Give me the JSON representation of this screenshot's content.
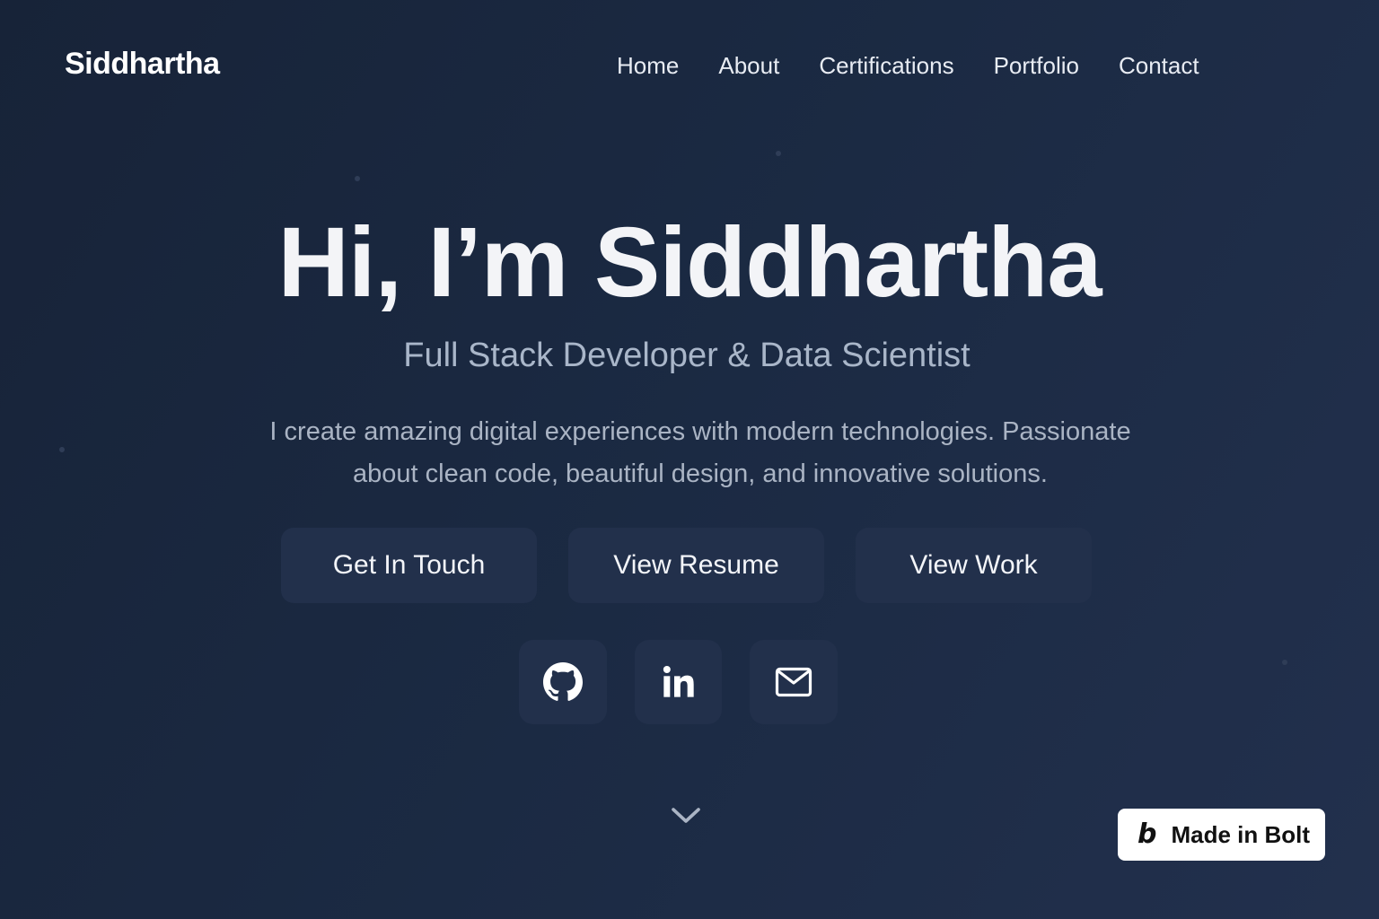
{
  "header": {
    "logo": "Siddhartha",
    "nav": [
      "Home",
      "About",
      "Certifications",
      "Portfolio",
      "Contact"
    ]
  },
  "hero": {
    "title": "Hi, I’m Siddhartha",
    "subtitle": "Full Stack Developer & Data Scientist",
    "description_line1": "I create amazing digital experiences with modern technologies. Passionate",
    "description_line2": "about clean code, beautiful design, and innovative solutions.",
    "buttons": [
      "Get In Touch",
      "View Resume",
      "View Work"
    ]
  },
  "social": {
    "icons": [
      "github-icon",
      "linkedin-icon",
      "mail-icon"
    ]
  },
  "scroll_indicator": {
    "icon": "chevron-down-icon"
  },
  "badge": {
    "logo": "b",
    "text": "Made in Bolt"
  },
  "colors": {
    "background_start": "#172338",
    "background_end": "#22304d",
    "button_bg": "#22304b",
    "subtitle": "#a9b6c9",
    "text": "#f3f4f7"
  }
}
